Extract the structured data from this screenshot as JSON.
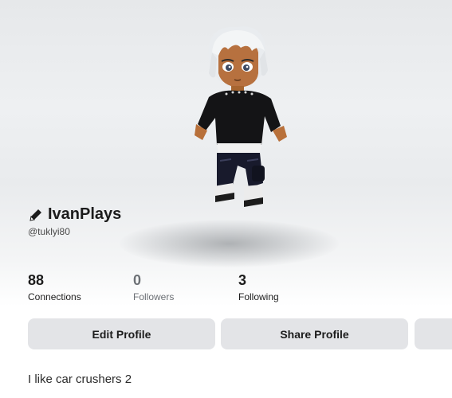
{
  "profile": {
    "display_name": "IvanPlays",
    "username": "@tuklyi80",
    "bio": "I like car crushers 2"
  },
  "stats": [
    {
      "value": "88",
      "label": "Connections"
    },
    {
      "value": "0",
      "label": "Followers"
    },
    {
      "value": "3",
      "label": "Following"
    }
  ],
  "actions": {
    "edit_label": "Edit Profile",
    "share_label": "Share Profile"
  },
  "icons": {
    "edit": "pencil-icon"
  },
  "colors": {
    "button_bg": "#e3e4e7",
    "muted_text": "#6c7075"
  }
}
